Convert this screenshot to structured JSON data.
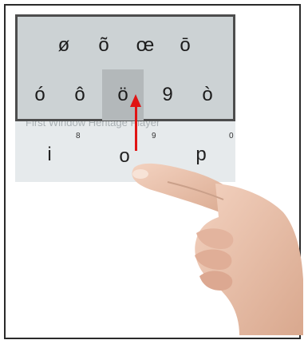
{
  "keyboard": {
    "underlying_text": "First Window Heritage Player",
    "keys": [
      {
        "label": "i",
        "number": "8"
      },
      {
        "label": "o",
        "number": "9"
      },
      {
        "label": "p",
        "number": "0"
      }
    ]
  },
  "popup": {
    "row1": [
      "ø",
      "õ",
      "œ",
      "ō"
    ],
    "row2": [
      "ó",
      "ô",
      "ö",
      "9",
      "ò"
    ],
    "selected": "ö"
  },
  "colors": {
    "arrow": "#e01414",
    "popup_bg": "#ccd2d4",
    "keyboard_bg": "#e6eaec"
  }
}
